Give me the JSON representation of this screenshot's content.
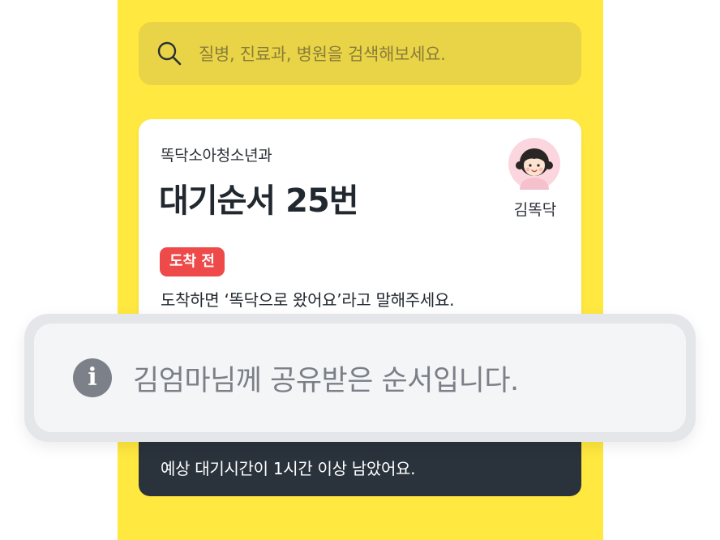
{
  "search": {
    "placeholder": "질병, 진료과, 병원을 검색해보세요.",
    "icon": "search-icon"
  },
  "card": {
    "clinic_name": "똑닥소아청소년과",
    "queue_number": "대기순서 25번",
    "patient_name": "김똑닥",
    "status_badge": "도착 전",
    "guide_text": "도착하면 ‘똑닥으로 왔어요’라고 말해주세요.",
    "badge_color": "#ee4a4a"
  },
  "wait_banner": {
    "text": "예상 대기시간이 1시간 이상 남았어요."
  },
  "toast": {
    "icon": "info-icon",
    "message": "김엄마님께 공유받은 순서입니다."
  },
  "colors": {
    "background_yellow": "#ffe83f",
    "search_bg": "#e9d447",
    "dark_bar": "#2a323c",
    "toast_bg": "#f4f5f7"
  }
}
